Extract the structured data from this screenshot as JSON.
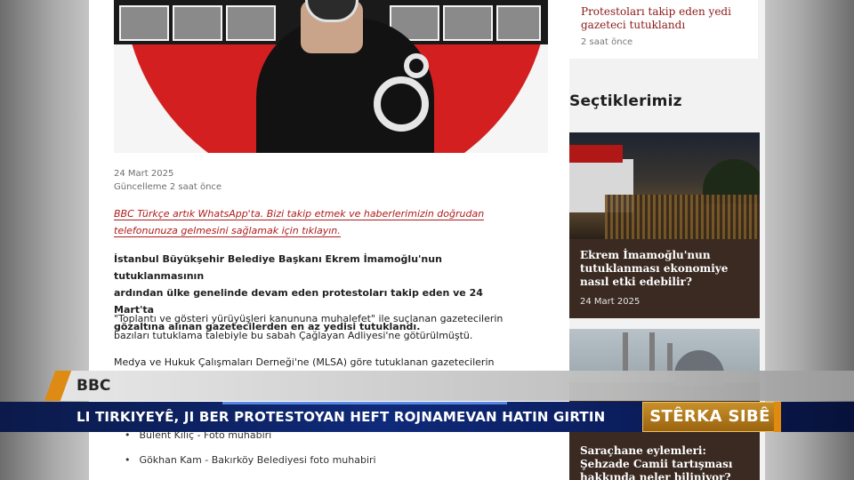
{
  "article": {
    "date": "24 Mart 2025",
    "updated": "Güncelleme 2 saat önce",
    "whatsapp_promo_line1": "BBC Türkçe artık WhatsApp'ta. Bizi takip etmek ve haberlerimizin doğrudan",
    "whatsapp_promo_line2": "telefonunuza gelmesini sağlamak için tıklayın.",
    "lead_line1": "İstanbul Büyükşehir Belediye Başkanı Ekrem İmamoğlu'nun tutuklanmasının",
    "lead_line2": "ardından ülke genelinde devam eden protestoları takip eden ve 24 Mart'ta",
    "lead_line3": "gözaltına alınan gazetecilerden en az yedisi tutuklandı.",
    "para2_line1": "\"Toplantı ve gösteri yürüyüşleri kanununa muhalefet\" ile suçlanan gazetecilerin",
    "para2_line2": "bazıları tutuklama talebiyle bu sabah Çağlayan Adliyesi'ne götürülmüştü.",
    "para3_line1": "Medya ve Hukuk Çalışmaları Derneği'ne (MLSA) göre tutuklanan gazetecilerin",
    "bullets": [
      "Bülent Kılıç - Foto muhabiri",
      "Gökhan Kam - Bakırköy Belediyesi foto muhabiri"
    ]
  },
  "sidebar": {
    "top_card_title": "Protestoları takip eden yedi gazeteci tutuklandı",
    "top_card_time": "2 saat önce",
    "section_title": "Seçtiklerimiz",
    "card1_title": "Ekrem İmamoğlu'nun tutuklanması ekonomiye nasıl etki edebilir?",
    "card1_date": "24 Mart 2025",
    "card2_title": "Saraçhane eylemleri: Şehzade Camii tartışması hakkında neler biliniyor?"
  },
  "overlay": {
    "source": "BBC",
    "headline": "LI TIRKIYEYÊ, JI BER PROTESTOYAN HEFT ROJNAMEVAN HATIN GIRTIN",
    "brand": "STÊRKA SIBÊ",
    "colors": {
      "accent": "#e08a10",
      "band": "#0f2a7a"
    }
  }
}
